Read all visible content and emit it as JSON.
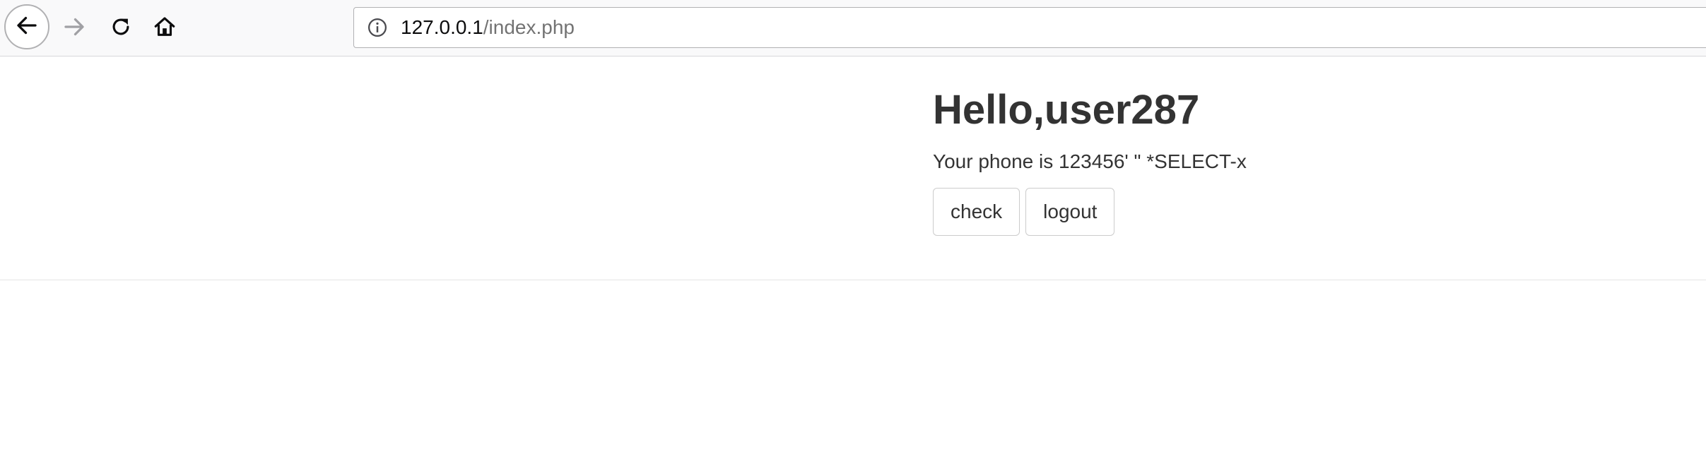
{
  "browser": {
    "url_host": "127.0.0.1",
    "url_path": "/index.php",
    "icons": {
      "back": "arrow-left-icon",
      "forward": "arrow-right-icon",
      "reload": "reload-icon",
      "home": "home-icon",
      "site_info": "info-icon"
    },
    "forward_enabled": false
  },
  "page": {
    "greeting": "Hello,user287",
    "phone_label": "Your phone is ",
    "phone_value": "123456' \" *SELECT-x",
    "buttons": {
      "check": "check",
      "logout": "logout"
    }
  },
  "colors": {
    "text": "#333333",
    "toolbar_bg": "#f9f9fa",
    "url_path": "#737373"
  }
}
